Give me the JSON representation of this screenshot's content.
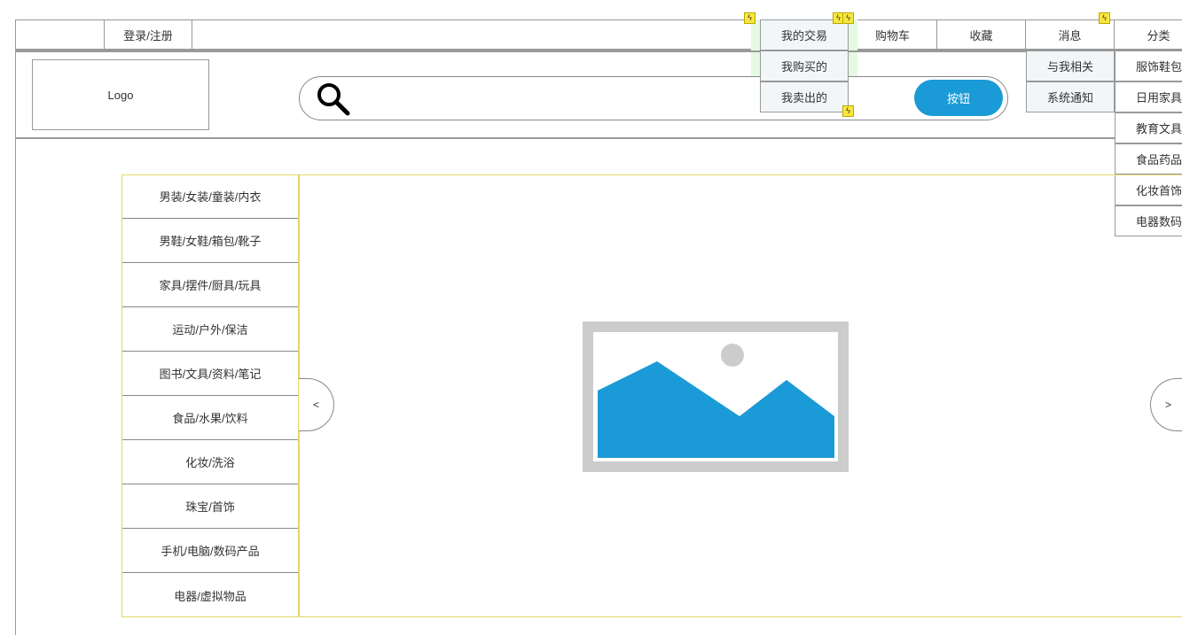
{
  "topnav": {
    "login_label": "登录/注册",
    "trade_label": "我的交易",
    "cart_label": "购物车",
    "favorites_label": "收藏",
    "messages_label": "消息",
    "category_label": "分类"
  },
  "trade_menu": {
    "items": [
      "我购买的",
      "我卖出的"
    ]
  },
  "message_menu": {
    "items": [
      "与我相关",
      "系统通知"
    ]
  },
  "category_menu": {
    "items": [
      "服饰鞋包",
      "日用家具",
      "教育文具",
      "食品药品",
      "化妆首饰",
      "电器数码"
    ]
  },
  "header": {
    "logo_text": "Logo",
    "search_button_label": "按钮",
    "search_icon": "search-icon"
  },
  "sidebar": {
    "categories": [
      "男装/女装/童装/内衣",
      "男鞋/女鞋/箱包/靴子",
      "家具/摆件/厨具/玩具",
      "运动/户外/保洁",
      "图书/文具/资料/笔记",
      "食品/水果/饮料",
      "化妆/洗浴",
      "珠宝/首饰",
      "手机/电脑/数码产品",
      "电器/虚拟物品"
    ]
  },
  "carousel": {
    "prev_label": "<",
    "next_label": ">",
    "image_icon": "image-placeholder-icon"
  },
  "annotations": {
    "interaction_marker_icon": "lightning-icon"
  },
  "colors": {
    "accent": "#1a9ad6",
    "highlight_green": "#e6f9e3",
    "marker_yellow": "#f7e73c",
    "frame_yellow": "#e3d76b"
  }
}
